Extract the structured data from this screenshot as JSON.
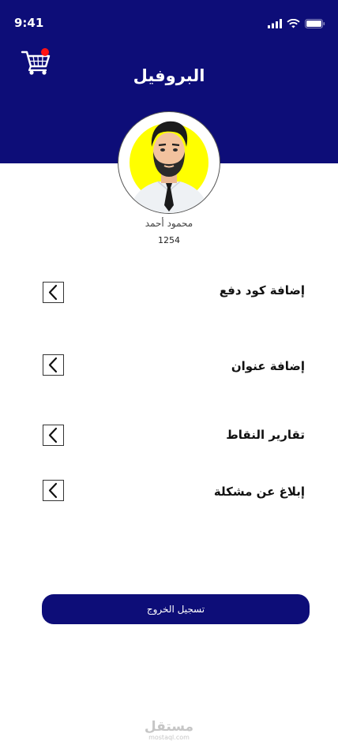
{
  "status_bar": {
    "time": "9:41"
  },
  "header": {
    "title": "البروفيل",
    "background": "#0d0d78"
  },
  "profile": {
    "name": "محمود أحمد",
    "id": "1254"
  },
  "menu": [
    {
      "label": "إضافة كود دفع"
    },
    {
      "label": "إضافة عنوان"
    },
    {
      "label": "تقارير النقاط"
    },
    {
      "label": "إبلاغ عن مشكلة"
    }
  ],
  "logout": {
    "label": "تسجيل الخروج"
  },
  "watermark": {
    "main": "مستقل",
    "sub": "mostaql.com"
  },
  "colors": {
    "accent": "#0d0d78",
    "cart_badge": "#ff1313",
    "avatar_bg": "#ffff00"
  }
}
